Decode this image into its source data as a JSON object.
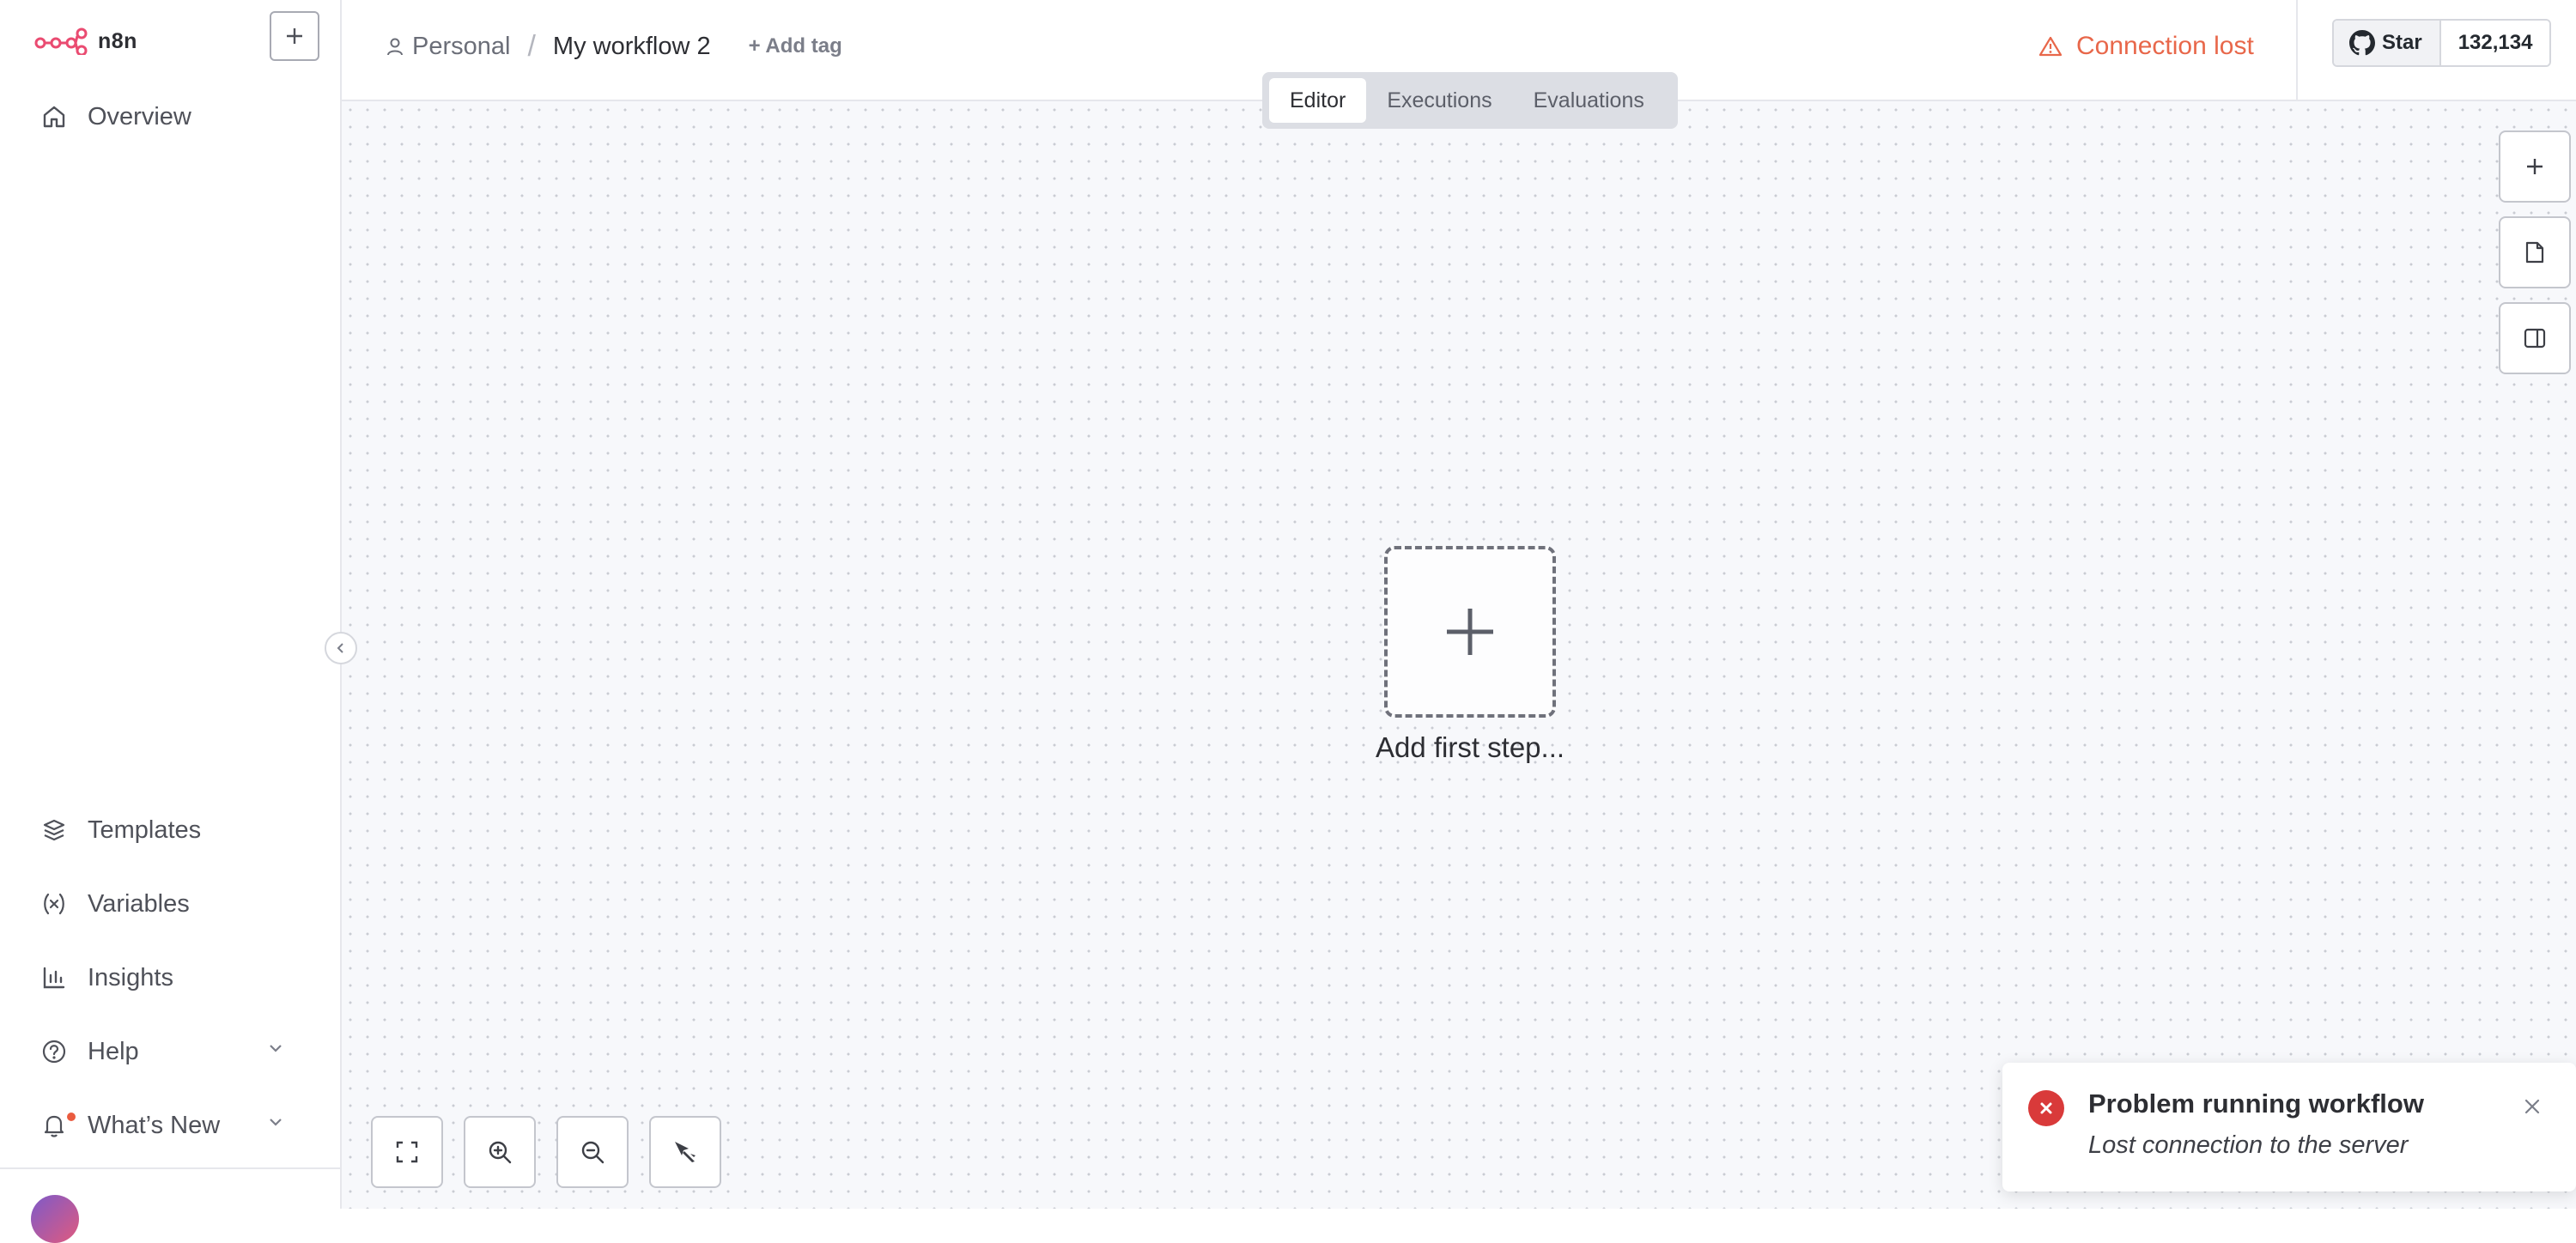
{
  "app": {
    "name": "n8n"
  },
  "colors": {
    "brand": "#ea4b71",
    "danger": "#d93a3a",
    "warning": "#e8674a"
  },
  "sidebar": {
    "new_button_icon": "plus-icon",
    "top_items": [
      {
        "label": "Overview",
        "icon": "home-icon"
      }
    ],
    "bottom_items": [
      {
        "label": "Templates",
        "icon": "templates-icon"
      },
      {
        "label": "Variables",
        "icon": "variables-icon"
      },
      {
        "label": "Insights",
        "icon": "insights-icon"
      },
      {
        "label": "Help",
        "icon": "help-icon"
      },
      {
        "label": "What’s New",
        "icon": "bell-icon"
      }
    ]
  },
  "header": {
    "breadcrumb": {
      "project": "Personal",
      "separator": "/",
      "workflow": "My workflow 2"
    },
    "add_tag": "+ Add tag",
    "connection_status": "Connection lost",
    "github": {
      "star_label": "Star",
      "star_count": "132,134"
    }
  },
  "tabs": [
    {
      "label": "Editor",
      "active": true
    },
    {
      "label": "Executions",
      "active": false
    },
    {
      "label": "Evaluations",
      "active": false
    }
  ],
  "canvas": {
    "add_first_step": "Add first step...",
    "side_tools": [
      "plus-icon",
      "sticky-note-icon",
      "panel-icon"
    ],
    "bottom_tools": [
      "fit-view-icon",
      "zoom-in-icon",
      "zoom-out-icon",
      "tidy-up-icon"
    ]
  },
  "toast": {
    "title": "Problem running workflow",
    "message": "Lost connection to the server"
  }
}
